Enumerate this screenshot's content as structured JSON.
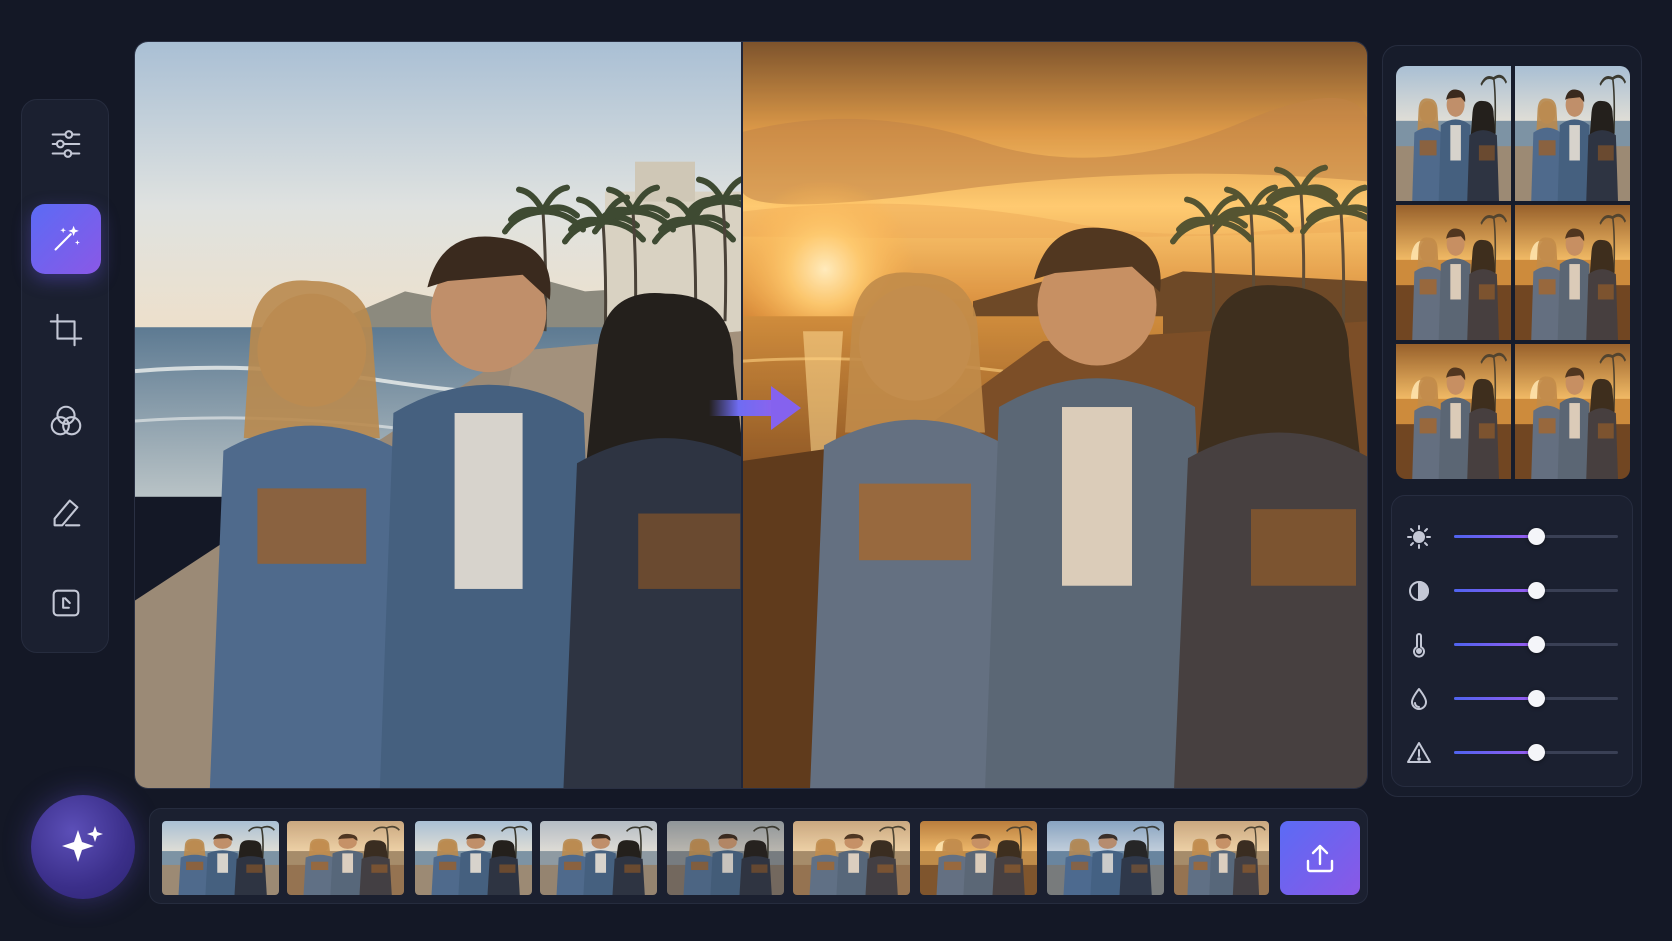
{
  "canvas": {
    "before_tone": "daylight",
    "after_tone": "golden-hour"
  },
  "tools": [
    {
      "name": "adjustments-tool",
      "icon": "sliders-icon",
      "active": false
    },
    {
      "name": "ai-enhance-tool",
      "icon": "magic-wand-icon",
      "active": true
    },
    {
      "name": "crop-tool",
      "icon": "crop-icon",
      "active": false
    },
    {
      "name": "color-mix-tool",
      "icon": "color-circles-icon",
      "active": false
    },
    {
      "name": "retouch-tool",
      "icon": "eraser-icon",
      "active": false
    },
    {
      "name": "frame-tool",
      "icon": "frame-icon",
      "active": false
    }
  ],
  "adjustments": [
    {
      "name": "brightness",
      "icon": "sun-icon",
      "value": 0.5
    },
    {
      "name": "contrast",
      "icon": "contrast-icon",
      "value": 0.5
    },
    {
      "name": "temperature",
      "icon": "thermometer-icon",
      "value": 0.5
    },
    {
      "name": "saturation",
      "icon": "droplet-icon",
      "value": 0.5
    },
    {
      "name": "sharpness",
      "icon": "warning-triangle-icon",
      "value": 0.5
    }
  ],
  "presets": [
    {
      "tone": "daylight"
    },
    {
      "tone": "daylight"
    },
    {
      "tone": "sunset"
    },
    {
      "tone": "sunset"
    },
    {
      "tone": "sunset"
    },
    {
      "tone": "sunset"
    }
  ],
  "filmstrip": [
    {
      "tone": "daylight"
    },
    {
      "tone": "warm"
    },
    {
      "tone": "daylight"
    },
    {
      "tone": "neutral"
    },
    {
      "tone": "muted"
    },
    {
      "tone": "warm"
    },
    {
      "tone": "golden"
    },
    {
      "tone": "cool"
    },
    {
      "tone": "warm"
    }
  ],
  "colors": {
    "accent_start": "#5b6bf5",
    "accent_end": "#8a58e6",
    "background": "#141826",
    "panel": "#1b2030"
  },
  "icons": {
    "magic": "sparkles-icon",
    "upload": "upload-icon",
    "compare": "arrow-right-icon"
  }
}
